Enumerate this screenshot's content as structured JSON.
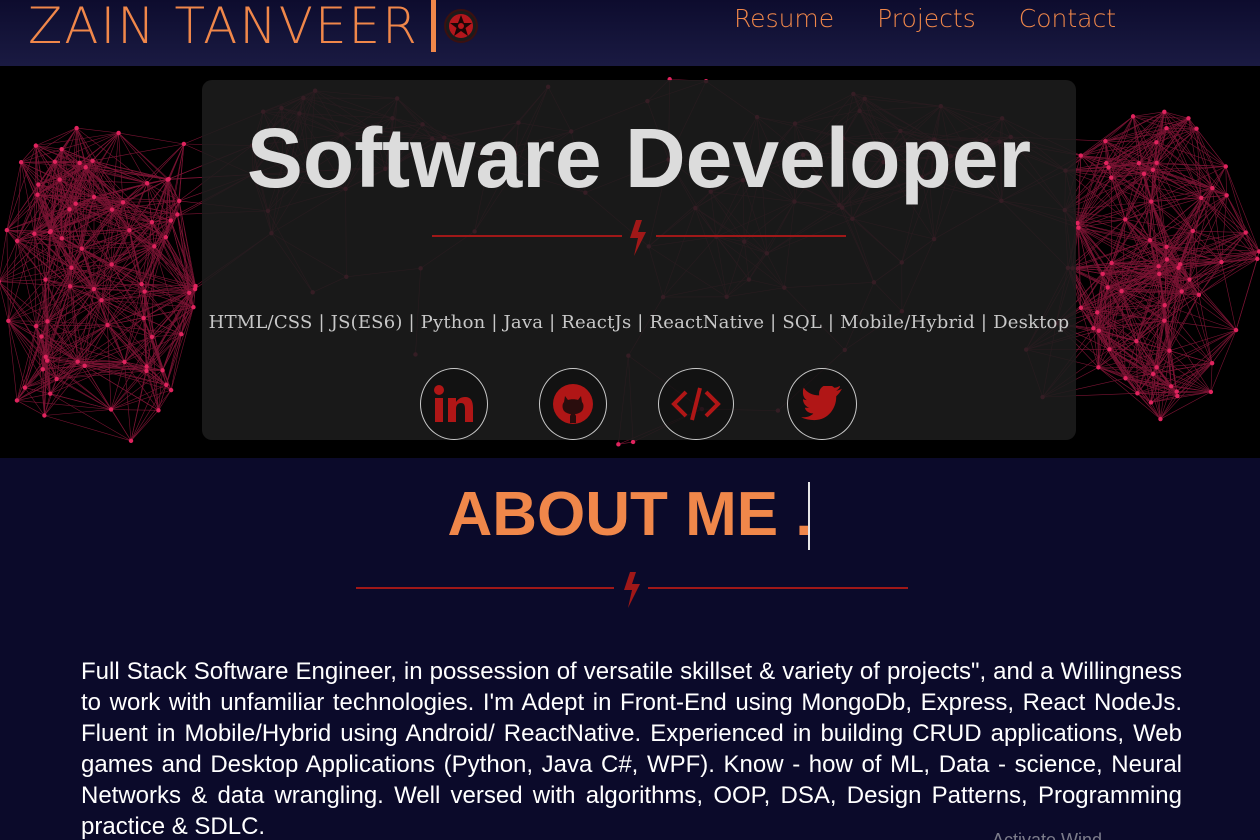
{
  "header": {
    "brand_name": "ZAIN TANVEER",
    "logo_icon": "sharingan-icon",
    "nav": [
      {
        "label": "Resume"
      },
      {
        "label": "Projects"
      },
      {
        "label": "Contact"
      }
    ]
  },
  "hero": {
    "title": "Software Developer",
    "divider_icon": "lightning-bolt-icon",
    "skills": "HTML/CSS | JS(ES6) | Python | Java | ReactJs | ReactNative | SQL | Mobile/Hybrid | Desktop",
    "socials": [
      {
        "icon": "linkedin-icon"
      },
      {
        "icon": "github-icon"
      },
      {
        "icon": "code-icon"
      },
      {
        "icon": "twitter-icon"
      }
    ]
  },
  "about": {
    "title": "ABOUT ME .",
    "divider_icon": "lightning-bolt-icon",
    "body": "Full Stack Software Engineer, in possession of versatile skillset & variety of projects\", and a Willingness to work with unfamiliar technologies. I'm Adept in Front-End using MongoDb, Express, React NodeJs. Fluent in Mobile/Hybrid using Android/ ReactNative. Experienced in building CRUD applications, Web games and Desktop Applications (Python, Java C#, WPF). Know - how of ML, Data - science, Neural Networks & data wrangling. Well versed with algorithms, OOP, DSA, Design Patterns, Programming practice & SDLC."
  },
  "watermark": "Activate Wind",
  "colors": {
    "accent": "#f0874a",
    "background": "#0b0a2a",
    "network": "#e0245e",
    "divider": "#a01818"
  }
}
